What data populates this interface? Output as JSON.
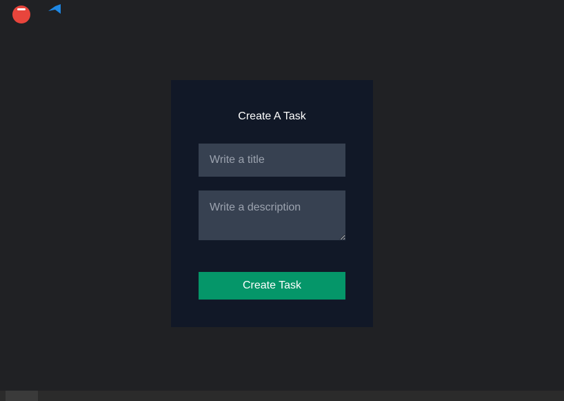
{
  "form": {
    "title": "Create A Task",
    "title_placeholder": "Write a title",
    "title_value": "",
    "description_placeholder": "Write a description",
    "description_value": "",
    "submit_label": "Create Task"
  },
  "taskbar": {
    "apps": [
      {
        "icon": "browser-icon",
        "active": true,
        "color": "#e8453c"
      },
      {
        "icon": "vscode-icon",
        "active": false,
        "color": "#1e88e5"
      }
    ]
  },
  "colors": {
    "background": "#202124",
    "card": "#111827",
    "input": "#374151",
    "button": "#059669"
  }
}
